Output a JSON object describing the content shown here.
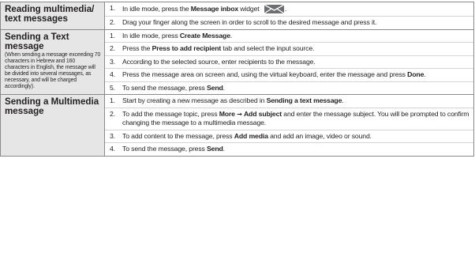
{
  "sections": [
    {
      "title": "Reading multimedia/ text messages",
      "note": "",
      "steps": [
        {
          "num": "1.",
          "parts": [
            {
              "t": "In idle mode, press the "
            },
            {
              "t": "Message inbox",
              "b": true
            },
            {
              "t": " widget "
            },
            {
              "icon": "envelope-icon"
            },
            {
              "t": "."
            }
          ]
        },
        {
          "num": "2.",
          "parts": [
            {
              "t": "Drag your finger along the screen in order to scroll to the desired message and press it."
            }
          ]
        }
      ]
    },
    {
      "title": "Sending a Text message",
      "note": "(When sending a message exceeding 70 characters in Hebrew and 160 characters in English, the message will be divided into several messages, as necessary, and will be charged accordingly).",
      "steps": [
        {
          "num": "1.",
          "parts": [
            {
              "t": "In idle mode, press "
            },
            {
              "t": "Create Message",
              "b": true
            },
            {
              "t": "."
            }
          ]
        },
        {
          "num": "2.",
          "parts": [
            {
              "t": "Press the "
            },
            {
              "t": "Press to add recipient",
              "b": true
            },
            {
              "t": " tab and select the input source."
            }
          ]
        },
        {
          "num": "3.",
          "parts": [
            {
              "t": "According to the selected source, enter recipients to the message."
            }
          ]
        },
        {
          "num": "4.",
          "parts": [
            {
              "t": "Press the message area on screen and, using the virtual keyboard, enter the message and press "
            },
            {
              "t": "Done",
              "b": true
            },
            {
              "t": "."
            }
          ]
        },
        {
          "num": "5.",
          "parts": [
            {
              "t": "To send the message, press "
            },
            {
              "t": "Send",
              "b": true
            },
            {
              "t": "."
            }
          ]
        }
      ]
    },
    {
      "title": "Sending a Multimedia message",
      "note": "",
      "steps": [
        {
          "num": "1.",
          "parts": [
            {
              "t": "Start by creating a new message as described in "
            },
            {
              "t": "Sending a text message",
              "b": true
            },
            {
              "t": "."
            }
          ]
        },
        {
          "num": "2.",
          "parts": [
            {
              "t": "To add the message topic, press "
            },
            {
              "t": "More",
              "b": true
            },
            {
              "t": " "
            },
            {
              "t": "→",
              "b": true,
              "arrow": true
            },
            {
              "t": " "
            },
            {
              "t": "Add subject",
              "b": true
            },
            {
              "t": " and enter the message subject. You will be prompted to confirm changing the message to a multimedia message."
            }
          ]
        },
        {
          "num": "3.",
          "parts": [
            {
              "t": "To add content to the message, press "
            },
            {
              "t": "Add media",
              "b": true
            },
            {
              "t": " and add an image, video or sound."
            }
          ]
        },
        {
          "num": "4.",
          "parts": [
            {
              "t": "To send the message, press "
            },
            {
              "t": "Send",
              "b": true
            },
            {
              "t": "."
            }
          ]
        }
      ]
    }
  ],
  "colors": {
    "header_bg": "#e6e6e6",
    "border": "#8a8a8a",
    "text": "#231f20",
    "icon_fill": "#6d6e71"
  }
}
